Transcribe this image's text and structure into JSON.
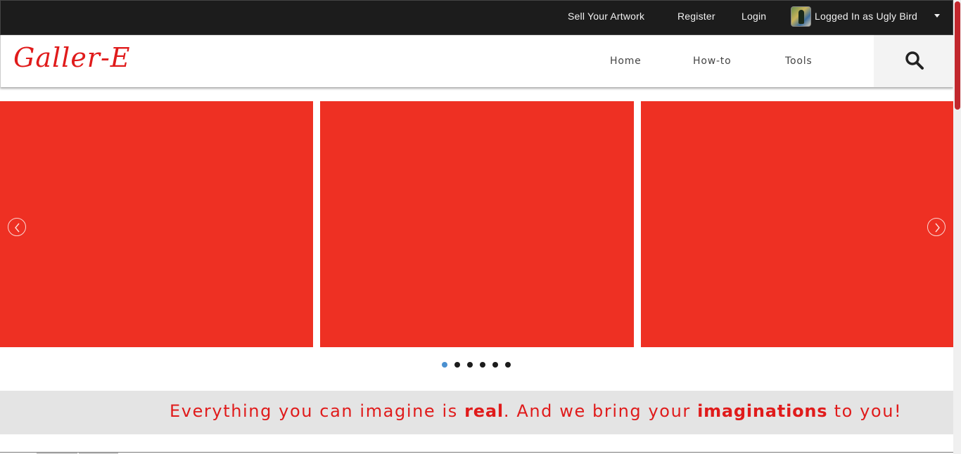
{
  "topbar": {
    "sell_label": "Sell Your Artwork",
    "register_label": "Register",
    "login_label": "Login",
    "user_label": "Logged In as Ugly Bird"
  },
  "header": {
    "logo": "Galler-E",
    "nav": [
      "Home",
      "How-to",
      "Tools"
    ],
    "search_icon": "search-icon"
  },
  "carousel": {
    "slide_color": "#ee3023",
    "prev_icon": "chevron-left-icon",
    "next_icon": "chevron-right-icon",
    "dot_count": 6,
    "active_dot": 0
  },
  "tagline": {
    "part1": "Everything you can imagine is ",
    "bold1": "real",
    "part2": ". And we bring your ",
    "bold2": "imaginations",
    "part3": " to you!"
  },
  "colors": {
    "accent": "#e01b1b",
    "topbar_bg": "#1c1c1c",
    "active_dot": "#4a90d0"
  }
}
